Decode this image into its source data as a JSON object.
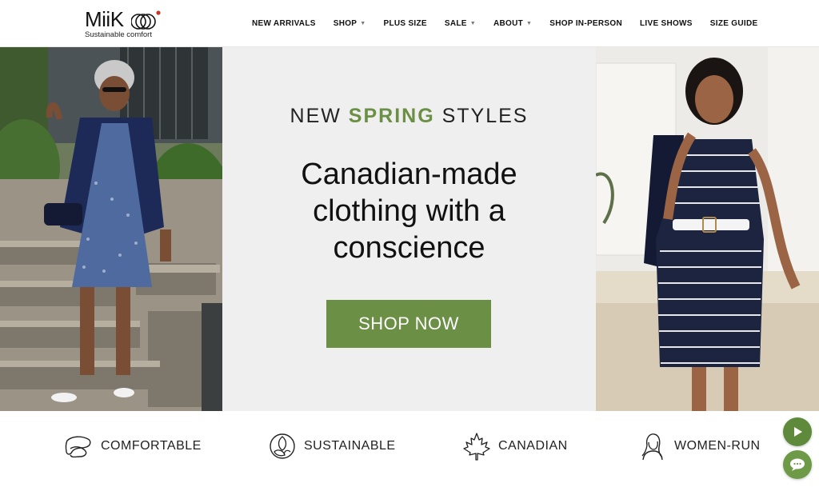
{
  "brand": {
    "name": "MiiK",
    "tagline": "Sustainable comfort",
    "accent_color": "#6b8f45"
  },
  "nav": {
    "items": [
      {
        "label": "NEW ARRIVALS",
        "dropdown": false
      },
      {
        "label": "SHOP",
        "dropdown": true
      },
      {
        "label": "PLUS SIZE",
        "dropdown": false
      },
      {
        "label": "SALE",
        "dropdown": true
      },
      {
        "label": "ABOUT",
        "dropdown": true
      },
      {
        "label": "SHOP IN-PERSON",
        "dropdown": false
      },
      {
        "label": "LIVE SHOWS",
        "dropdown": false
      },
      {
        "label": "SIZE GUIDE",
        "dropdown": false
      }
    ]
  },
  "hero": {
    "eyebrow_prefix": "NEW",
    "eyebrow_accent": "SPRING",
    "eyebrow_suffix": "STYLES",
    "headline": "Canadian-made clothing with a conscience",
    "cta_label": "SHOP NOW"
  },
  "features": [
    {
      "label": "COMFORTABLE",
      "icon": "socks-icon"
    },
    {
      "label": "SUSTAINABLE",
      "icon": "leaf-globe-icon"
    },
    {
      "label": "CANADIAN",
      "icon": "maple-leaf-icon"
    },
    {
      "label": "WOMEN-RUN",
      "icon": "woman-icon"
    }
  ],
  "widgets": {
    "play_icon": "play-icon",
    "chat_icon": "chat-icon"
  }
}
